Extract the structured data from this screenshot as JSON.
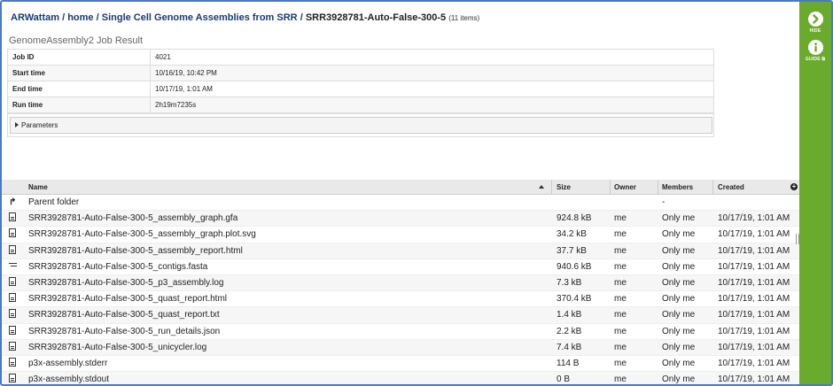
{
  "breadcrumb": {
    "items": [
      "ARWattam",
      "home",
      "Single Cell Genome Assemblies from SRR"
    ],
    "current": "SRR3928781-Auto-False-300-5",
    "count": "(11 items)"
  },
  "job_title": "GenomeAssembly2 Job Result",
  "info": [
    {
      "key": "Job ID",
      "value": "4021"
    },
    {
      "key": "Start time",
      "value": "10/16/19, 10:42 PM"
    },
    {
      "key": "End time",
      "value": "10/17/19, 1:01 AM"
    },
    {
      "key": "Run time",
      "value": "2h19m7235s"
    }
  ],
  "parameters_label": "Parameters",
  "sidebar": {
    "hide_label": "HIDE",
    "guide_label": "GUIDE ⧉"
  },
  "table": {
    "headers": {
      "name": "Name",
      "size": "Size",
      "owner": "Owner",
      "members": "Members",
      "created": "Created"
    },
    "parent": {
      "name": "Parent folder",
      "members": "-"
    },
    "rows": [
      {
        "icon": "document-icon",
        "name": "SRR3928781-Auto-False-300-5_assembly_graph.gfa",
        "size": "924.8 kB",
        "owner": "me",
        "members": "Only me",
        "created": "10/17/19, 1:01 AM"
      },
      {
        "icon": "document-icon",
        "name": "SRR3928781-Auto-False-300-5_assembly_graph.plot.svg",
        "size": "34.2 kB",
        "owner": "me",
        "members": "Only me",
        "created": "10/17/19, 1:01 AM"
      },
      {
        "icon": "document-icon",
        "name": "SRR3928781-Auto-False-300-5_assembly_report.html",
        "size": "37.7 kB",
        "owner": "me",
        "members": "Only me",
        "created": "10/17/19, 1:01 AM"
      },
      {
        "icon": "fasta-icon",
        "name": "SRR3928781-Auto-False-300-5_contigs.fasta",
        "size": "940.6 kB",
        "owner": "me",
        "members": "Only me",
        "created": "10/17/19, 1:01 AM"
      },
      {
        "icon": "document-icon",
        "name": "SRR3928781-Auto-False-300-5_p3_assembly.log",
        "size": "7.3 kB",
        "owner": "me",
        "members": "Only me",
        "created": "10/17/19, 1:01 AM"
      },
      {
        "icon": "document-icon",
        "name": "SRR3928781-Auto-False-300-5_quast_report.html",
        "size": "370.4 kB",
        "owner": "me",
        "members": "Only me",
        "created": "10/17/19, 1:01 AM"
      },
      {
        "icon": "document-icon",
        "name": "SRR3928781-Auto-False-300-5_quast_report.txt",
        "size": "1.4 kB",
        "owner": "me",
        "members": "Only me",
        "created": "10/17/19, 1:01 AM"
      },
      {
        "icon": "document-icon",
        "name": "SRR3928781-Auto-False-300-5_run_details.json",
        "size": "2.2 kB",
        "owner": "me",
        "members": "Only me",
        "created": "10/17/19, 1:01 AM"
      },
      {
        "icon": "document-icon",
        "name": "SRR3928781-Auto-False-300-5_unicycler.log",
        "size": "7.4 kB",
        "owner": "me",
        "members": "Only me",
        "created": "10/17/19, 1:01 AM"
      },
      {
        "icon": "document-icon",
        "name": "p3x-assembly.stderr",
        "size": "114 B",
        "owner": "me",
        "members": "Only me",
        "created": "10/17/19, 1:01 AM"
      },
      {
        "icon": "document-icon",
        "name": "p3x-assembly.stdout",
        "size": "0 B",
        "owner": "me",
        "members": "Only me",
        "created": "10/17/19, 1:01 AM"
      }
    ]
  },
  "colors": {
    "accent_green": "#6aaa2c",
    "link_blue": "#1a3a73",
    "frame_blue": "#4a78c8"
  }
}
